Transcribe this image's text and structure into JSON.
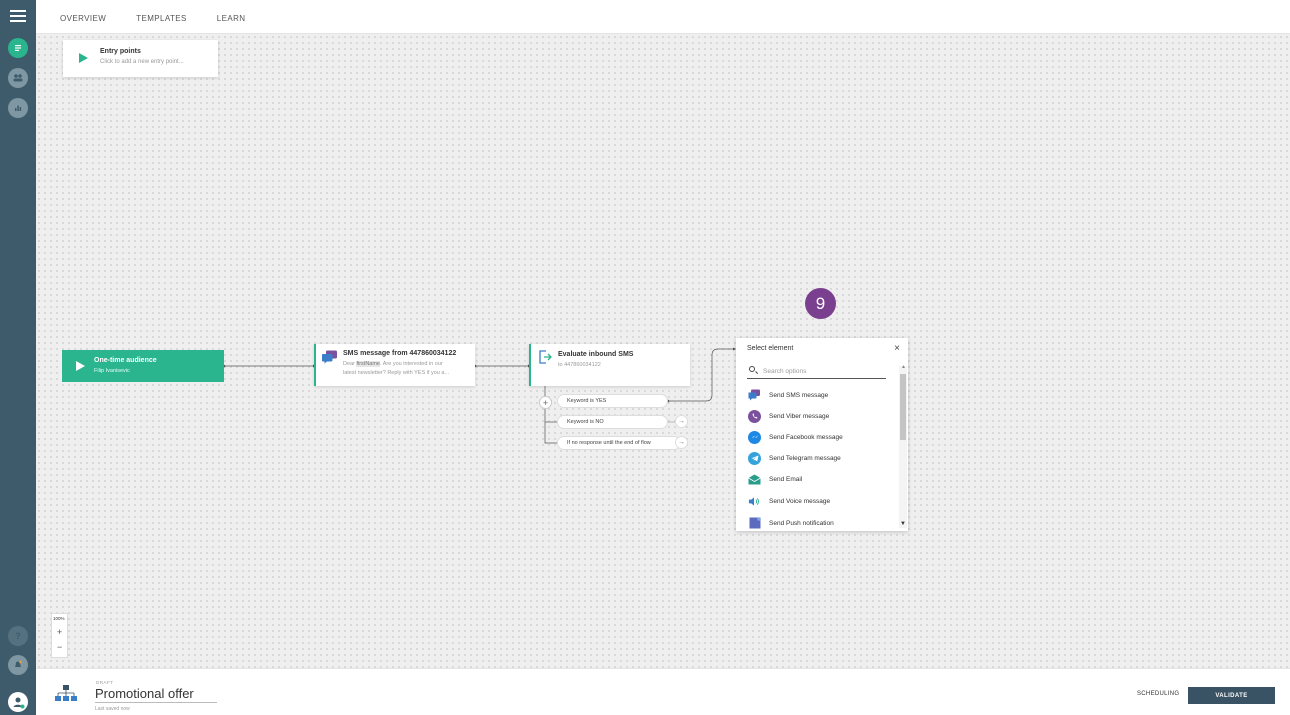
{
  "topnav": {
    "items": [
      "OVERVIEW",
      "TEMPLATES",
      "LEARN"
    ]
  },
  "colors": {
    "rail": "#3d5b6b",
    "accent": "#2ab58f",
    "badge": "#7b3f8f",
    "validate": "#3a5364"
  },
  "sidebar": {
    "icons": [
      "menu-icon",
      "flow-icon",
      "people-icon",
      "analytics-icon",
      "help-icon",
      "bell-icon",
      "user-avatar-icon"
    ]
  },
  "entry_points": {
    "title": "Entry points",
    "subtitle": "Click to add a new entry point..."
  },
  "audience_node": {
    "title": "One-time audience",
    "subtitle": "Filip Ivanisevic"
  },
  "sms_node": {
    "title": "SMS message from 447860034122",
    "body_prefix": "Dear ",
    "body_var": "firstName",
    "body_suffix": ". Are you interested in our",
    "body_line2": "latest newsletter? Reply with YES if you a..."
  },
  "evaluate_node": {
    "title": "Evaluate inbound SMS",
    "subtitle": "to 447860034122"
  },
  "branches": [
    "Keyword is YES",
    "Keyword is NO",
    "If no response until the end of flow"
  ],
  "badge": {
    "number": "9"
  },
  "select_panel": {
    "title": "Select element",
    "close": "×",
    "search_placeholder": "Search options",
    "options": [
      {
        "label": "Send SMS message",
        "icon": "sms-icon",
        "color": "#3a7dc9"
      },
      {
        "label": "Send Viber message",
        "icon": "viber-icon",
        "color": "#7b519d"
      },
      {
        "label": "Send Facebook message",
        "icon": "messenger-icon",
        "color": "#1e88e5"
      },
      {
        "label": "Send Telegram message",
        "icon": "telegram-icon",
        "color": "#34a3dc"
      },
      {
        "label": "Send Email",
        "icon": "email-icon",
        "color": "#2a9c8a"
      },
      {
        "label": "Send Voice message",
        "icon": "voice-icon",
        "color": "#3a7dc9"
      },
      {
        "label": "Send Push notification",
        "icon": "push-icon",
        "color": "#5c6bc0"
      }
    ]
  },
  "zoom": {
    "level": "100%",
    "plus": "+",
    "minus": "−"
  },
  "bottom": {
    "status": "DRAFT",
    "flow_name": "Promotional offer",
    "saved": "Last saved now",
    "scheduling": "SCHEDULING",
    "validate": "VALIDATE"
  }
}
